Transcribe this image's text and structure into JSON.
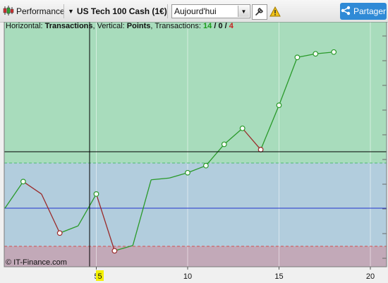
{
  "toolbar": {
    "performance_label": "Performance",
    "instrument_label": "US Tech 100 Cash (1€)",
    "period_value": "Aujourd'hui",
    "share_label": "Partager"
  },
  "info": {
    "horizontal_prefix": "Horizontal: ",
    "horizontal_value": "Transactions",
    "vertical_prefix": ", Vertical: ",
    "vertical_value": "Points",
    "transactions_prefix": ", Transactions: ",
    "count_win": "14",
    "slash1": " / ",
    "count_neutral": "0",
    "slash2": " / ",
    "count_loss": "4"
  },
  "copyright": "© IT-Finance.com",
  "cursor_x_label": "5",
  "colors": {
    "zone_upper": "#a8dcbc",
    "zone_middle": "#b2cddd",
    "zone_lower": "#c2a9b8",
    "up": "#2a9a2a",
    "down": "#9a2a2a",
    "baseline": "#2233cc",
    "count_win": "#1a9a1a",
    "count_loss": "#c82020",
    "share_button": "#2f8ad6"
  },
  "chart_data": {
    "type": "line",
    "x_ticks": [
      5,
      10,
      15,
      20
    ],
    "xlim": [
      0,
      21
    ],
    "x": [
      0,
      1,
      2,
      3,
      4,
      5,
      6,
      7,
      8,
      9,
      10,
      11,
      12,
      13,
      14,
      15,
      16,
      17,
      18
    ],
    "y": [
      0,
      1.5,
      0.8,
      -1.4,
      -1.0,
      0.8,
      -2.4,
      -2.1,
      1.6,
      1.7,
      2.0,
      2.4,
      3.6,
      4.5,
      3.3,
      5.8,
      8.5,
      8.7,
      8.8
    ],
    "ylim": [
      -3.3,
      10.5
    ],
    "grid": true,
    "baseline_y": 0
  }
}
